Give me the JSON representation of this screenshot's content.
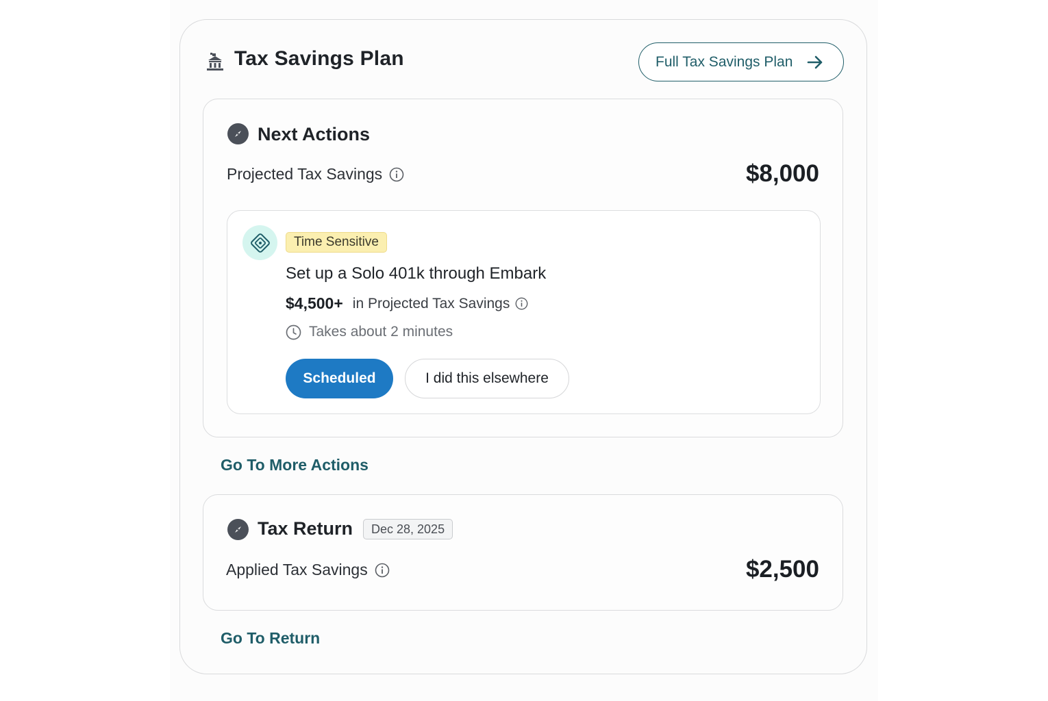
{
  "header": {
    "title": "Tax Savings Plan",
    "icon": "bank-building-icon",
    "full_plan_label": "Full Tax Savings Plan"
  },
  "next_actions": {
    "title": "Next Actions",
    "icon": "compass-icon",
    "projected_label": "Projected Tax Savings",
    "projected_amount": "$8,000",
    "action": {
      "icon": "embark-diamond-icon",
      "badge": "Time Sensitive",
      "title": "Set up a Solo 401k through Embark",
      "savings_amount": "$4,500+",
      "savings_text": "in Projected Tax Savings",
      "time_text": "Takes about 2 minutes",
      "scheduled_label": "Scheduled",
      "elsewhere_label": "I did this elsewhere"
    },
    "more_link": "Go To More Actions"
  },
  "tax_return": {
    "title": "Tax Return",
    "icon": "compass-icon",
    "date": "Dec 28, 2025",
    "applied_label": "Applied Tax Savings",
    "applied_amount": "$2,500",
    "return_link": "Go To Return"
  },
  "colors": {
    "accent": "#1f5d68",
    "primary_button": "#1e7ac4",
    "badge_yellow": "#fbefb0",
    "icon_mint": "#d5f5ef"
  }
}
